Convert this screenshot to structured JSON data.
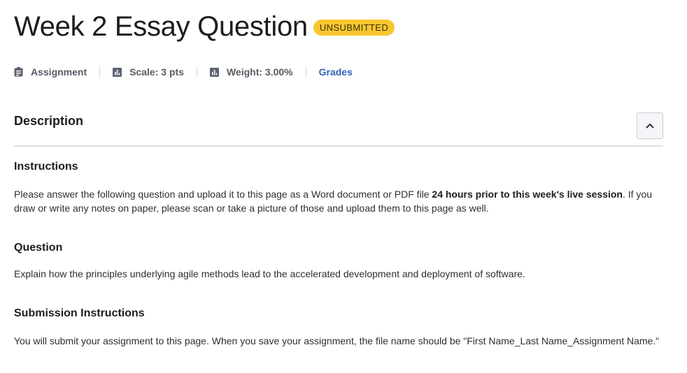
{
  "header": {
    "title": "Week 2 Essay Question",
    "status": "UNSUBMITTED",
    "status_color": "#f8c630"
  },
  "meta": {
    "type": {
      "icon": "assignment-icon",
      "label": "Assignment"
    },
    "scale": {
      "icon": "chart-icon",
      "label": "Scale: 3 pts"
    },
    "weight": {
      "icon": "chart-icon",
      "label": "Weight: 3.00%"
    },
    "grades_link": "Grades",
    "link_color": "#2e63b6"
  },
  "description": {
    "title": "Description",
    "collapse_icon": "chevron-up-icon",
    "instructions": {
      "heading": "Instructions",
      "text_before": "Please answer the following question and upload it to this page as a Word document or PDF file ",
      "text_bold": "24 hours prior to this week's live session",
      "text_after": ". If you draw or write any notes on paper, please scan or take a picture of those and upload them to this page as well."
    },
    "question": {
      "heading": "Question",
      "text": "Explain how the principles underlying agile methods lead to the accelerated development and deployment of software."
    },
    "submission": {
      "heading": "Submission Instructions",
      "text": "You will submit your assignment to this page. When you save your assignment, the file name should be \"First Name_Last Name_Assignment Name.\""
    }
  }
}
